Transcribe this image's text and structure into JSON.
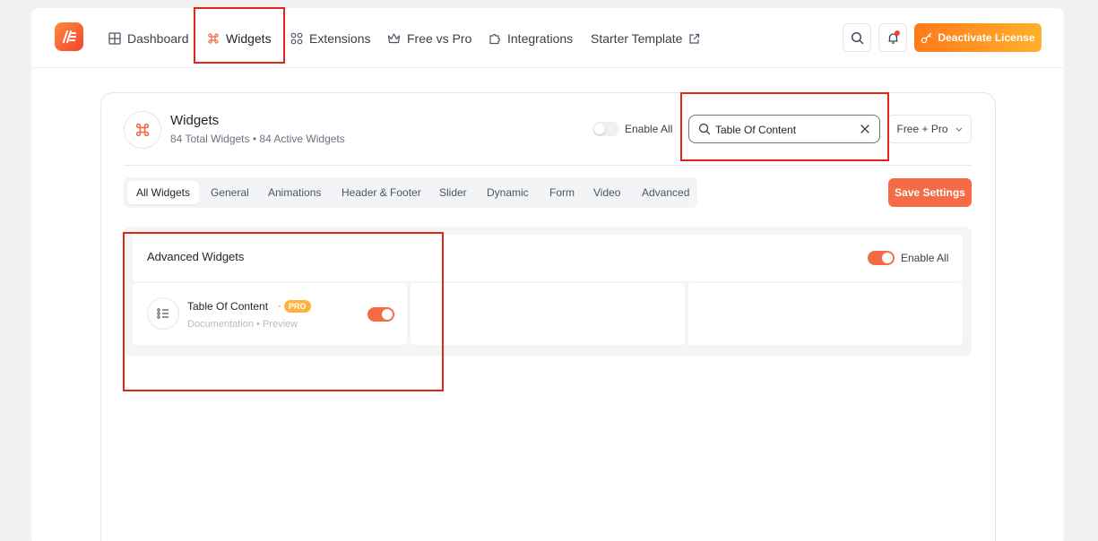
{
  "nav": {
    "items": [
      {
        "label": "Dashboard",
        "icon": "grid-icon"
      },
      {
        "label": "Widgets",
        "icon": "command-icon"
      },
      {
        "label": "Extensions",
        "icon": "extensions-icon"
      },
      {
        "label": "Free vs Pro",
        "icon": "crown-icon"
      },
      {
        "label": "Integrations",
        "icon": "puzzle-icon"
      },
      {
        "label": "Starter Template",
        "icon": "external-link-icon"
      }
    ],
    "active": "Widgets",
    "deactivate_label": "Deactivate License"
  },
  "widgets_panel": {
    "title": "Widgets",
    "total": "84 Total Widgets",
    "separator": "•",
    "active_count": "84 Active Widgets",
    "enable_all_label": "Enable All",
    "enable_all_on": false,
    "search": {
      "value": "Table Of Content",
      "placeholder": ""
    },
    "filter_label": "Free + Pro",
    "save_label": "Save Settings",
    "tabs": [
      "All Widgets",
      "General",
      "Animations",
      "Header & Footer",
      "Slider",
      "Dynamic",
      "Form",
      "Video",
      "Advanced"
    ],
    "active_tab": "All Widgets"
  },
  "section": {
    "title": "Advanced Widgets",
    "enable_all_label": "Enable All",
    "enable_all_on": true,
    "items": [
      {
        "title": "Table Of Content",
        "dot": "·",
        "badge": "PRO",
        "links": "Documentation • Preview",
        "enabled": true
      }
    ]
  },
  "colors": {
    "accent": "#f46b45",
    "pro_badge": "#ffb23e",
    "highlight_box": "#e1251b"
  }
}
